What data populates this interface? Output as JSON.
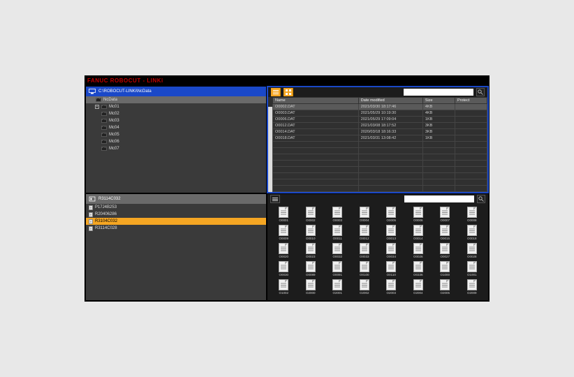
{
  "title": "FANUC ROBOCUT - LINKi",
  "top_left": {
    "path": "C:\\ROBOCUT-LINKi\\NcData",
    "tree": [
      {
        "label": "NcData",
        "level": 0,
        "sel": true,
        "toggle": ""
      },
      {
        "label": "Mc01",
        "level": 1,
        "sel": false,
        "toggle": "+"
      },
      {
        "label": "Mc02",
        "level": 1,
        "sel": false,
        "toggle": ""
      },
      {
        "label": "Mc03",
        "level": 1,
        "sel": false,
        "toggle": ""
      },
      {
        "label": "Mc04",
        "level": 1,
        "sel": false,
        "toggle": ""
      },
      {
        "label": "Mc05",
        "level": 1,
        "sel": false,
        "toggle": ""
      },
      {
        "label": "Mc06",
        "level": 1,
        "sel": false,
        "toggle": ""
      },
      {
        "label": "Mc07",
        "level": 1,
        "sel": false,
        "toggle": ""
      }
    ]
  },
  "top_right": {
    "search_placeholder": "",
    "cols": {
      "c0": "Name",
      "c1": "Date modified",
      "c2": "Size",
      "c3": "Protect"
    },
    "rows": [
      {
        "name": "O0002.DAT",
        "date": "2021/03/30 18:17:46",
        "size": "4KB",
        "prot": "",
        "sel": true
      },
      {
        "name": "O0003.DAT",
        "date": "2021/05/29 10:19:30",
        "size": "4KB",
        "prot": "",
        "sel": false
      },
      {
        "name": "O0006.DAT",
        "date": "2021/05/29 17:09:04",
        "size": "1KB",
        "prot": "",
        "sel": false
      },
      {
        "name": "O0012.DAT",
        "date": "2021/03/08 18:17:52",
        "size": "3KB",
        "prot": "",
        "sel": false
      },
      {
        "name": "O0014.DAT",
        "date": "2020/03/18 18:16:33",
        "size": "3KB",
        "prot": "",
        "sel": false
      },
      {
        "name": "O0018.DAT",
        "date": "2021/03/31 13:08:42",
        "size": "1KB",
        "prot": "",
        "sel": false
      }
    ]
  },
  "bottom_left": {
    "path": "R3114C032",
    "items": [
      {
        "label": "P17J4B253",
        "sel": false
      },
      {
        "label": "R20406286",
        "sel": false
      },
      {
        "label": "R3104C032",
        "sel": true
      },
      {
        "label": "R3114C028",
        "sel": false
      }
    ]
  },
  "bottom_right": {
    "search_placeholder": "",
    "thumbs": [
      "O0001",
      "O0002",
      "O0003",
      "O0004",
      "O0005",
      "O0006",
      "O0007",
      "O0008",
      "O0009",
      "O0010",
      "O0011",
      "O0012",
      "O0013",
      "O0014",
      "O0015",
      "O0018",
      "O0020",
      "O0023",
      "O0032",
      "O0033",
      "O0034",
      "O0026",
      "O0027",
      "O0028",
      "O0030",
      "O0089",
      "O0091",
      "O0100",
      "O0110",
      "O0336",
      "O1000",
      "O1001",
      "O1002",
      "O2000",
      "O2001",
      "O2002",
      "O2003",
      "O2004",
      "O2005",
      "O2009"
    ]
  }
}
